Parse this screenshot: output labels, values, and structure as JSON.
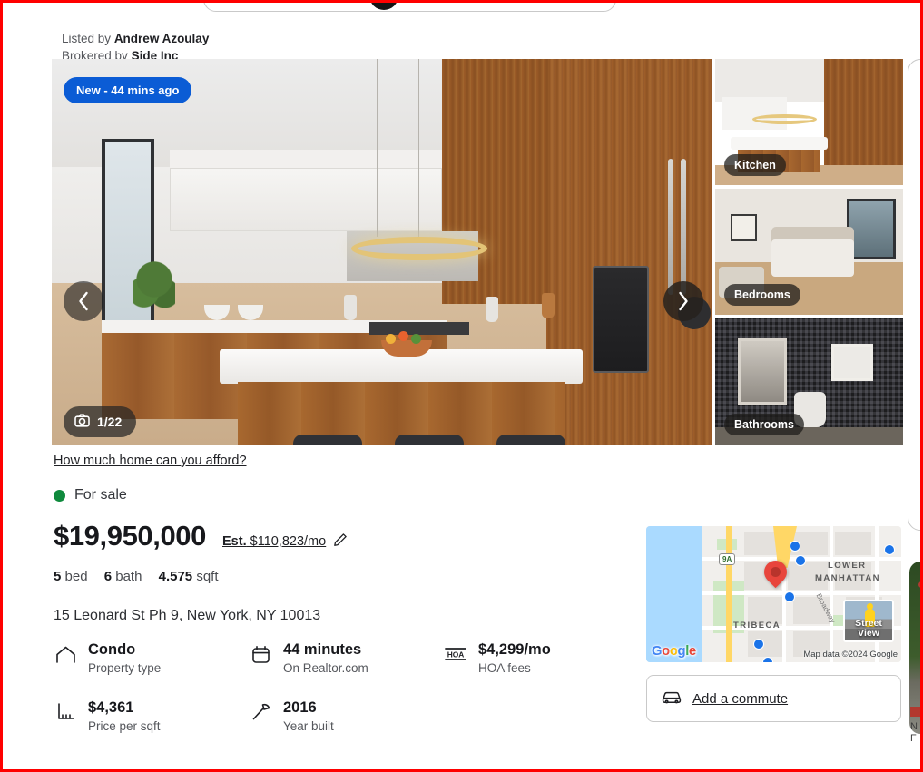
{
  "listing": {
    "listed_by_prefix": "Listed by",
    "listed_by_name": "Andrew Azoulay",
    "brokered_by_prefix": "Brokered by",
    "brokered_by_name": "Side Inc",
    "badge_new": "New - 44 mins ago",
    "photo_count": "1/22",
    "afford_link": "How much home can you afford?",
    "status": "For sale",
    "status_color": "#0f8a3d",
    "price": "$19,950,000",
    "est_prefix": "Est.",
    "est_value": "$110,823/mo",
    "beds": "5",
    "beds_label": "bed",
    "baths": "6",
    "baths_label": "bath",
    "sqft": "4.575",
    "sqft_label": "sqft",
    "address": "15 Leonard St Ph 9, New York, NY 10013",
    "badge_color": "#0b5cd5"
  },
  "thumbnails": [
    {
      "label": "Kitchen"
    },
    {
      "label": "Bedrooms"
    },
    {
      "label": "Bathrooms"
    }
  ],
  "facts": [
    {
      "value": "Condo",
      "label": "Property type",
      "icon": "home-icon"
    },
    {
      "value": "44 minutes",
      "label": "On Realtor.com",
      "icon": "calendar-icon"
    },
    {
      "value": "$4,299/mo",
      "label": "HOA fees",
      "icon": "hoa-icon"
    },
    {
      "value": "$4,361",
      "label": "Price per sqft",
      "icon": "ruler-icon"
    },
    {
      "value": "2016",
      "label": "Year built",
      "icon": "hammer-icon"
    }
  ],
  "map": {
    "neighborhood_1": "LOWER",
    "neighborhood_2": "MANHATTAN",
    "neighborhood_3": "TRIBECA",
    "street": "Broadway",
    "route_shield": "9A",
    "google_logo": "Google",
    "attribution": "Map data ©2024 Google",
    "street_view_line1": "Street",
    "street_view_line2": "View"
  },
  "commute": {
    "label": "Add a commute"
  },
  "right_card": {
    "line1": "N",
    "line2": "F"
  }
}
